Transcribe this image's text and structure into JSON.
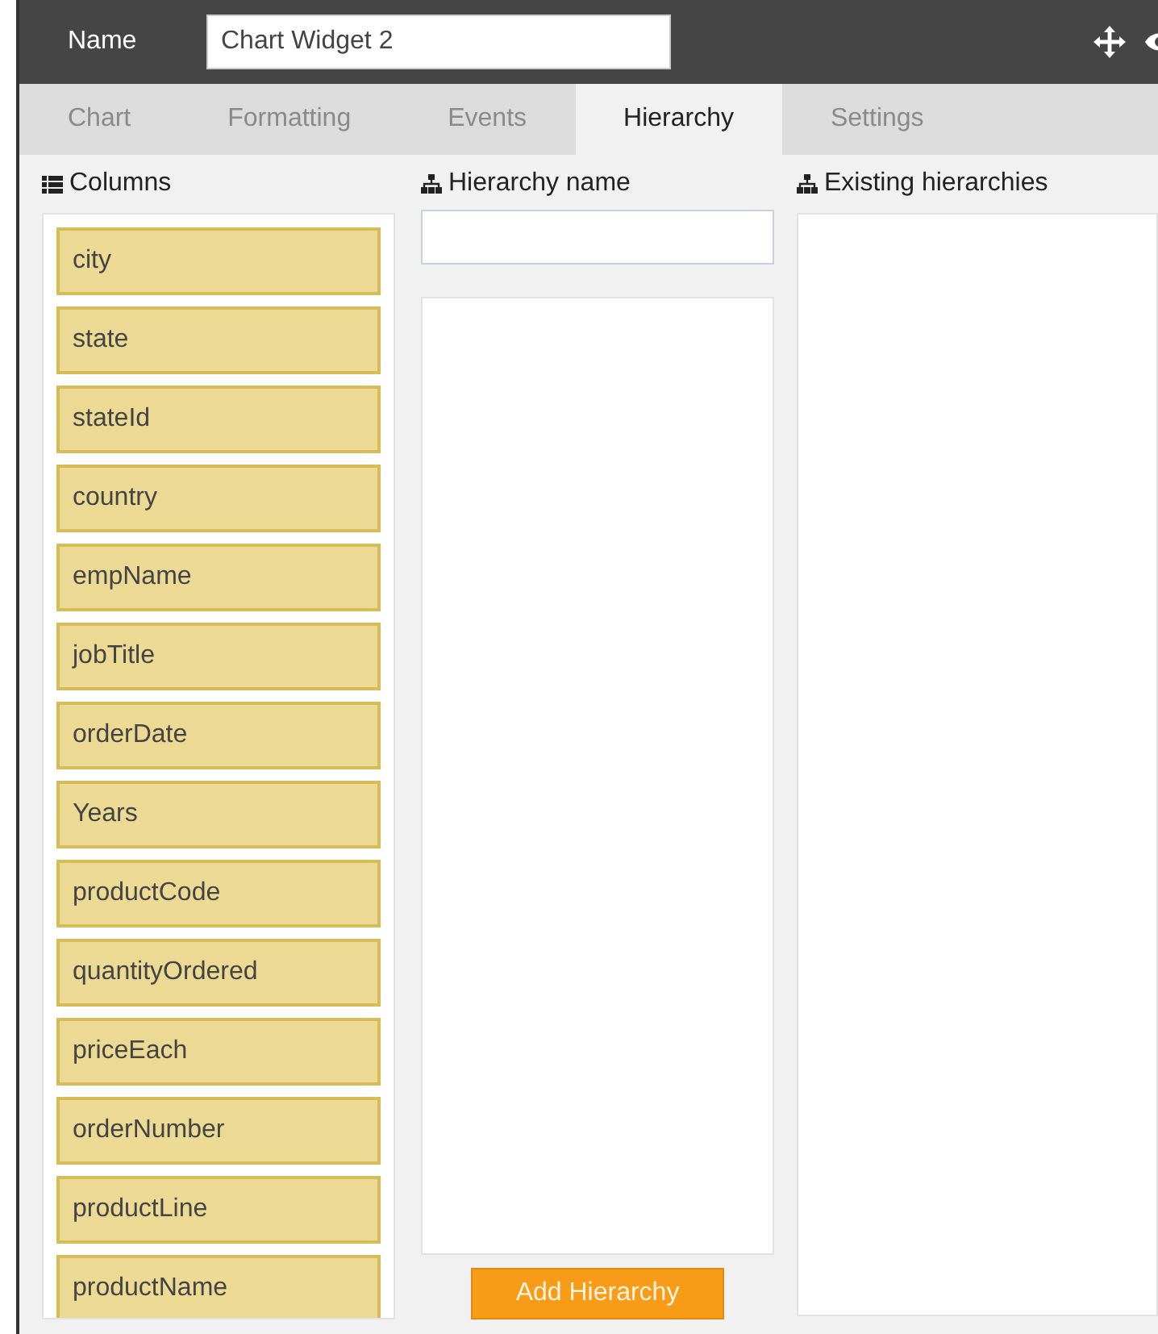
{
  "header": {
    "label": "Name",
    "value": "Chart Widget 2"
  },
  "tabs": [
    {
      "label": "Chart",
      "selected": false
    },
    {
      "label": "Formatting",
      "selected": false
    },
    {
      "label": "Events",
      "selected": false
    },
    {
      "label": "Hierarchy",
      "selected": true
    },
    {
      "label": "Settings",
      "selected": false
    }
  ],
  "columns": {
    "heading": "Columns",
    "items": [
      "city",
      "state",
      "stateId",
      "country",
      "empName",
      "jobTitle",
      "orderDate",
      "Years",
      "productCode",
      "quantityOrdered",
      "priceEach",
      "orderNumber",
      "productLine",
      "productName"
    ]
  },
  "hierarchy": {
    "heading": "Hierarchy name",
    "button": "Add Hierarchy"
  },
  "existing": {
    "heading": "Existing hierarchies"
  }
}
